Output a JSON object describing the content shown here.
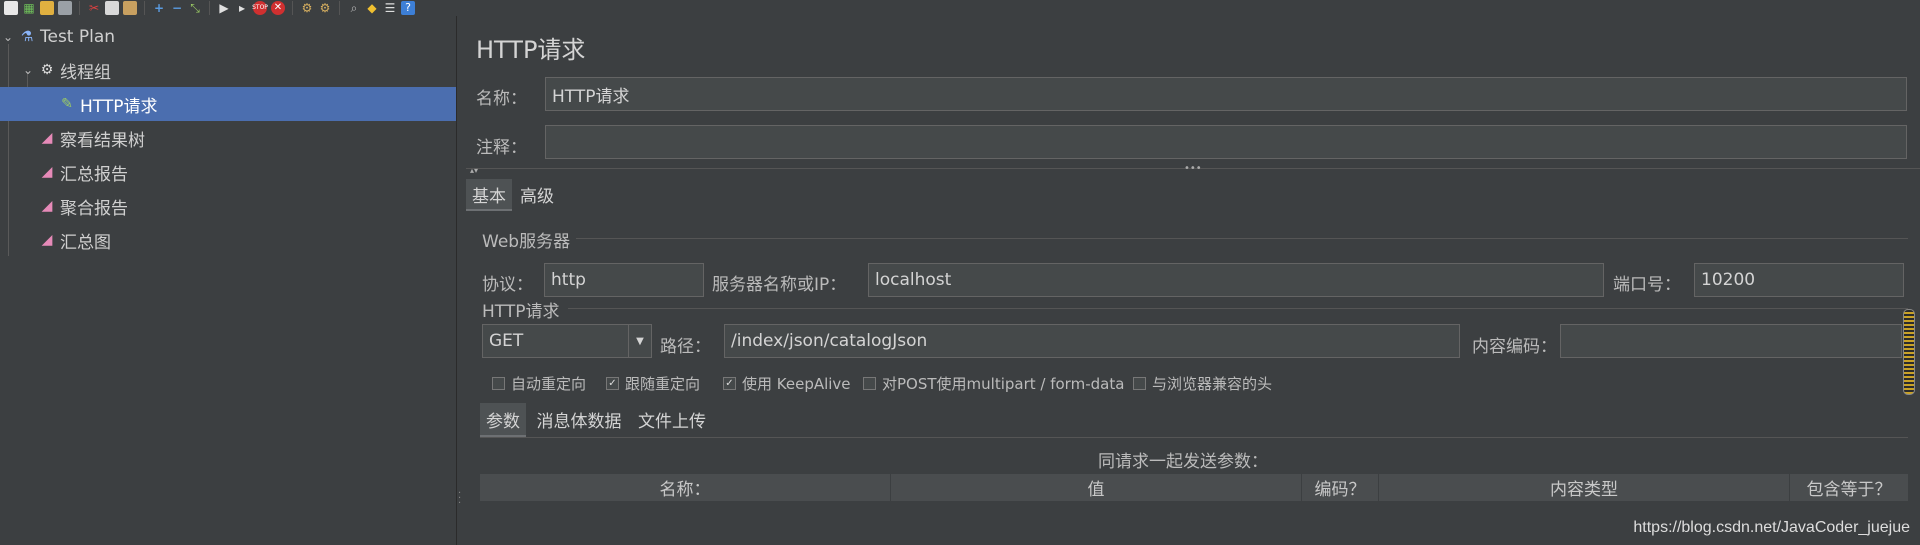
{
  "toolbar": {
    "icons": [
      "new-icon",
      "templates-icon",
      "open-icon",
      "save-icon",
      "cut-icon",
      "copy-icon",
      "paste-icon",
      "expand-icon",
      "collapse-icon",
      "toggle-icon",
      "start-icon",
      "start-no-pause-icon",
      "stop-icon",
      "shutdown-icon",
      "clear-icon",
      "clear-all-icon",
      "search-icon",
      "reset-search-icon",
      "function-helper-icon",
      "help-icon"
    ]
  },
  "tree": {
    "items": [
      {
        "label": "Test Plan",
        "icon": "flask-icon"
      },
      {
        "label": "线程组",
        "icon": "gear-icon"
      },
      {
        "label": "HTTP请求",
        "icon": "pencil-icon"
      },
      {
        "label": "察看结果树",
        "icon": "chart-icon"
      },
      {
        "label": "汇总报告",
        "icon": "chart-icon"
      },
      {
        "label": "聚合报告",
        "icon": "chart-icon"
      },
      {
        "label": "汇总图",
        "icon": "chart-icon"
      }
    ]
  },
  "panel": {
    "title": "HTTP请求",
    "name_label": "名称：",
    "name_value": "HTTP请求",
    "comment_label": "注释：",
    "comment_value": "",
    "tabs": [
      "基本",
      "高级"
    ],
    "web_server": {
      "section": "Web服务器",
      "protocol_label": "协议：",
      "protocol_value": "http",
      "server_label": "服务器名称或IP：",
      "server_value": "localhost",
      "port_label": "端口号：",
      "port_value": "10200"
    },
    "http_request": {
      "section": "HTTP请求",
      "method": "GET",
      "path_label": "路径：",
      "path_value": "/index/json/catalogJson",
      "encoding_label": "内容编码：",
      "encoding_value": ""
    },
    "checkboxes": [
      {
        "label": "自动重定向",
        "checked": false
      },
      {
        "label": "跟随重定向",
        "checked": true
      },
      {
        "label": "使用 KeepAlive",
        "checked": true
      },
      {
        "label": "对POST使用multipart / form-data",
        "checked": false
      },
      {
        "label": "与浏览器兼容的头",
        "checked": false
      }
    ],
    "sub_tabs": [
      "参数",
      "消息体数据",
      "文件上传"
    ],
    "params_caption": "同请求一起发送参数：",
    "table_headers": [
      "名称：",
      "值",
      "编码？",
      "内容类型",
      "包含等于？"
    ]
  },
  "watermark": "https://blog.csdn.net/JavaCoder_juejue"
}
